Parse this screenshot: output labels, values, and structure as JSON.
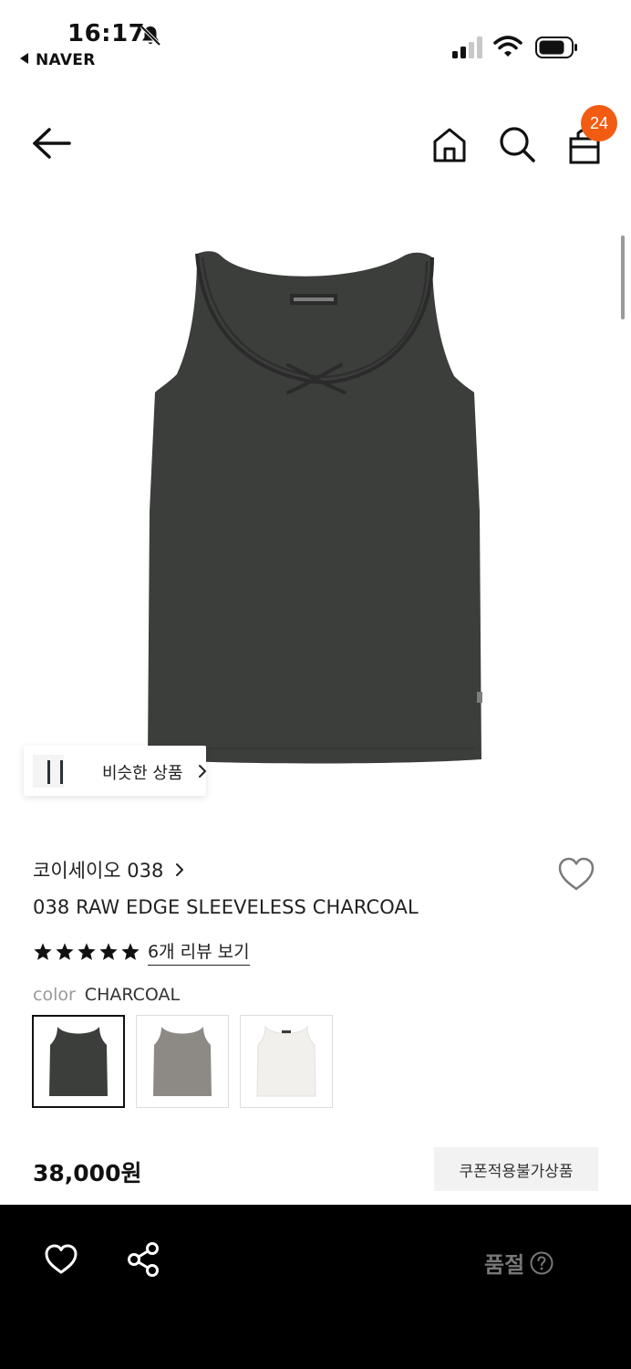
{
  "status_bar": {
    "time": "16:17",
    "back_app": "NAVER",
    "icons": [
      "bell-muted-icon",
      "signal-icon",
      "wifi-icon",
      "battery-icon"
    ]
  },
  "nav": {
    "icons": [
      "back-arrow-icon",
      "home-icon",
      "search-icon",
      "bag-icon"
    ],
    "cart_count": "24"
  },
  "similar": {
    "label": "비슷한 상품"
  },
  "product": {
    "brand": "코이세이오 038",
    "name": "038 RAW EDGE SLEEVELESS CHARCOAL",
    "rating": 5,
    "review_link": "6개 리뷰 보기",
    "color_key": "color",
    "color_value": "CHARCOAL",
    "swatches": [
      {
        "color": "#3c3e3c",
        "selected": true
      },
      {
        "color": "#8d8a86",
        "selected": false
      },
      {
        "color": "#f1f0ec",
        "selected": false
      }
    ],
    "price": "38,000원",
    "coupon_note": "쿠폰적용불가상품"
  },
  "bottom_bar": {
    "status": "품절",
    "icons": [
      "heart-icon",
      "share-icon",
      "help-icon"
    ]
  },
  "colors": {
    "badge": "#f25c12",
    "product": "#3c3e3c",
    "bottom_bar": "#000000"
  }
}
